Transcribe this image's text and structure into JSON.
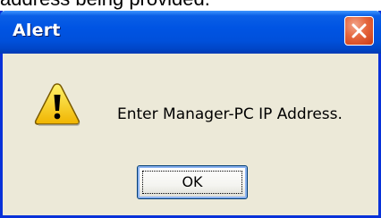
{
  "background": {
    "partial_text": "address being provided."
  },
  "dialog": {
    "title": "Alert",
    "message": "Enter Manager-PC IP Address.",
    "ok_label": "OK"
  },
  "icons": {
    "dialog_icon": "warning-icon",
    "close_icon": "close-icon"
  },
  "colors": {
    "titlebar": "#0054e3",
    "frame": "#0831d9",
    "body": "#ece9d8",
    "close_button": "#e5663d",
    "warning_fill": "#ffd700"
  }
}
